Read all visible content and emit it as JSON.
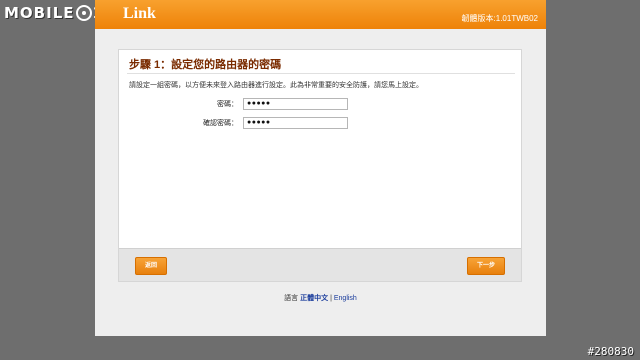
{
  "watermark": {
    "left": "MOBILE",
    "right": "1"
  },
  "photo_id": "#280830",
  "header": {
    "logo": "Link",
    "firmware": "韌體版本:1.01TWB02"
  },
  "step": {
    "title": "步驟 1：設定您的路由器的密碼",
    "instructions": "請設定一組密碼，以方便未來登入路由器進行設定。此為非常重要的安全防護，請您馬上設定。"
  },
  "fields": [
    {
      "label": "密碼：",
      "value": "●●●●●"
    },
    {
      "label": "確認密碼：",
      "value": "●●●●●"
    }
  ],
  "buttons": {
    "back": "返回",
    "next": "下一步"
  },
  "language": {
    "label": "語言",
    "zh": "正體中文",
    "separator": "|",
    "en": "English"
  }
}
